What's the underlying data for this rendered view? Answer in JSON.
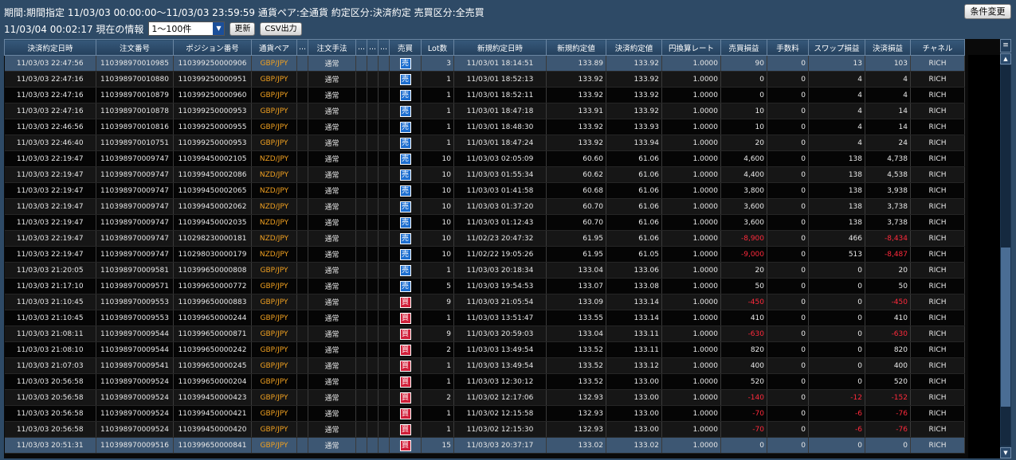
{
  "header": {
    "conditions": "期間:期間指定  11/03/03 00:00:00～11/03/03 23:59:59   通貨ペア:全通貨   約定区分:決済約定   売買区分:全売買",
    "change_button": "条件変更",
    "info": "11/03/04 00:02:17 現在の情報",
    "range_value": "1～100件",
    "refresh_button": "更新",
    "csv_button": "CSV出力"
  },
  "table": {
    "columns": [
      "決済約定日時",
      "注文番号",
      "ポジション番号",
      "通貨ペア",
      "...",
      "注文手法",
      "...",
      "...",
      "...",
      "売買",
      "Lot数",
      "新規約定日時",
      "新規約定値",
      "決済約定値",
      "円換算レート",
      "売買損益",
      "手数料",
      "スワップ損益",
      "決済損益",
      "チャネル"
    ],
    "rows": [
      [
        "11/03/03 22:47:56",
        "110398970010985",
        "110399250000906",
        "GBP/JPY",
        "",
        "通常",
        "",
        "",
        "",
        "売",
        "3",
        "11/03/01 18:14:51",
        "133.89",
        "133.92",
        "1.0000",
        "90",
        "0",
        "13",
        "103",
        "RICH"
      ],
      [
        "11/03/03 22:47:16",
        "110398970010880",
        "110399250000951",
        "GBP/JPY",
        "",
        "通常",
        "",
        "",
        "",
        "売",
        "1",
        "11/03/01 18:52:13",
        "133.92",
        "133.92",
        "1.0000",
        "0",
        "0",
        "4",
        "4",
        "RICH"
      ],
      [
        "11/03/03 22:47:16",
        "110398970010879",
        "110399250000960",
        "GBP/JPY",
        "",
        "通常",
        "",
        "",
        "",
        "売",
        "1",
        "11/03/01 18:52:11",
        "133.92",
        "133.92",
        "1.0000",
        "0",
        "0",
        "4",
        "4",
        "RICH"
      ],
      [
        "11/03/03 22:47:16",
        "110398970010878",
        "110399250000953",
        "GBP/JPY",
        "",
        "通常",
        "",
        "",
        "",
        "売",
        "1",
        "11/03/01 18:47:18",
        "133.91",
        "133.92",
        "1.0000",
        "10",
        "0",
        "4",
        "14",
        "RICH"
      ],
      [
        "11/03/03 22:46:56",
        "110398970010816",
        "110399250000955",
        "GBP/JPY",
        "",
        "通常",
        "",
        "",
        "",
        "売",
        "1",
        "11/03/01 18:48:30",
        "133.92",
        "133.93",
        "1.0000",
        "10",
        "0",
        "4",
        "14",
        "RICH"
      ],
      [
        "11/03/03 22:46:40",
        "110398970010751",
        "110399250000953",
        "GBP/JPY",
        "",
        "通常",
        "",
        "",
        "",
        "売",
        "1",
        "11/03/01 18:47:24",
        "133.92",
        "133.94",
        "1.0000",
        "20",
        "0",
        "4",
        "24",
        "RICH"
      ],
      [
        "11/03/03 22:19:47",
        "110398970009747",
        "110399450002105",
        "NZD/JPY",
        "",
        "通常",
        "",
        "",
        "",
        "売",
        "10",
        "11/03/03 02:05:09",
        "60.60",
        "61.06",
        "1.0000",
        "4,600",
        "0",
        "138",
        "4,738",
        "RICH"
      ],
      [
        "11/03/03 22:19:47",
        "110398970009747",
        "110399450002086",
        "NZD/JPY",
        "",
        "通常",
        "",
        "",
        "",
        "売",
        "10",
        "11/03/03 01:55:34",
        "60.62",
        "61.06",
        "1.0000",
        "4,400",
        "0",
        "138",
        "4,538",
        "RICH"
      ],
      [
        "11/03/03 22:19:47",
        "110398970009747",
        "110399450002065",
        "NZD/JPY",
        "",
        "通常",
        "",
        "",
        "",
        "売",
        "10",
        "11/03/03 01:41:58",
        "60.68",
        "61.06",
        "1.0000",
        "3,800",
        "0",
        "138",
        "3,938",
        "RICH"
      ],
      [
        "11/03/03 22:19:47",
        "110398970009747",
        "110399450002062",
        "NZD/JPY",
        "",
        "通常",
        "",
        "",
        "",
        "売",
        "10",
        "11/03/03 01:37:20",
        "60.70",
        "61.06",
        "1.0000",
        "3,600",
        "0",
        "138",
        "3,738",
        "RICH"
      ],
      [
        "11/03/03 22:19:47",
        "110398970009747",
        "110399450002035",
        "NZD/JPY",
        "",
        "通常",
        "",
        "",
        "",
        "売",
        "10",
        "11/03/03 01:12:43",
        "60.70",
        "61.06",
        "1.0000",
        "3,600",
        "0",
        "138",
        "3,738",
        "RICH"
      ],
      [
        "11/03/03 22:19:47",
        "110398970009747",
        "110298230000181",
        "NZD/JPY",
        "",
        "通常",
        "",
        "",
        "",
        "売",
        "10",
        "11/02/23 20:47:32",
        "61.95",
        "61.06",
        "1.0000",
        "-8,900",
        "0",
        "466",
        "-8,434",
        "RICH"
      ],
      [
        "11/03/03 22:19:47",
        "110398970009747",
        "110298030000179",
        "NZD/JPY",
        "",
        "通常",
        "",
        "",
        "",
        "売",
        "10",
        "11/02/22 19:05:26",
        "61.95",
        "61.05",
        "1.0000",
        "-9,000",
        "0",
        "513",
        "-8,487",
        "RICH"
      ],
      [
        "11/03/03 21:20:05",
        "110398970009581",
        "110399650000808",
        "GBP/JPY",
        "",
        "通常",
        "",
        "",
        "",
        "売",
        "1",
        "11/03/03 20:18:34",
        "133.04",
        "133.06",
        "1.0000",
        "20",
        "0",
        "0",
        "20",
        "RICH"
      ],
      [
        "11/03/03 21:17:10",
        "110398970009571",
        "110399650000772",
        "GBP/JPY",
        "",
        "通常",
        "",
        "",
        "",
        "売",
        "5",
        "11/03/03 19:54:53",
        "133.07",
        "133.08",
        "1.0000",
        "50",
        "0",
        "0",
        "50",
        "RICH"
      ],
      [
        "11/03/03 21:10:45",
        "110398970009553",
        "110399650000883",
        "GBP/JPY",
        "",
        "通常",
        "",
        "",
        "",
        "買",
        "9",
        "11/03/03 21:05:54",
        "133.09",
        "133.14",
        "1.0000",
        "-450",
        "0",
        "0",
        "-450",
        "RICH"
      ],
      [
        "11/03/03 21:10:45",
        "110398970009553",
        "110399650000244",
        "GBP/JPY",
        "",
        "通常",
        "",
        "",
        "",
        "買",
        "1",
        "11/03/03 13:51:47",
        "133.55",
        "133.14",
        "1.0000",
        "410",
        "0",
        "0",
        "410",
        "RICH"
      ],
      [
        "11/03/03 21:08:11",
        "110398970009544",
        "110399650000871",
        "GBP/JPY",
        "",
        "通常",
        "",
        "",
        "",
        "買",
        "9",
        "11/03/03 20:59:03",
        "133.04",
        "133.11",
        "1.0000",
        "-630",
        "0",
        "0",
        "-630",
        "RICH"
      ],
      [
        "11/03/03 21:08:10",
        "110398970009544",
        "110399650000242",
        "GBP/JPY",
        "",
        "通常",
        "",
        "",
        "",
        "買",
        "2",
        "11/03/03 13:49:54",
        "133.52",
        "133.11",
        "1.0000",
        "820",
        "0",
        "0",
        "820",
        "RICH"
      ],
      [
        "11/03/03 21:07:03",
        "110398970009541",
        "110399650000245",
        "GBP/JPY",
        "",
        "通常",
        "",
        "",
        "",
        "買",
        "1",
        "11/03/03 13:49:54",
        "133.52",
        "133.12",
        "1.0000",
        "400",
        "0",
        "0",
        "400",
        "RICH"
      ],
      [
        "11/03/03 20:56:58",
        "110398970009524",
        "110399650000204",
        "GBP/JPY",
        "",
        "通常",
        "",
        "",
        "",
        "買",
        "1",
        "11/03/03 12:30:12",
        "133.52",
        "133.00",
        "1.0000",
        "520",
        "0",
        "0",
        "520",
        "RICH"
      ],
      [
        "11/03/03 20:56:58",
        "110398970009524",
        "110399450000423",
        "GBP/JPY",
        "",
        "通常",
        "",
        "",
        "",
        "買",
        "2",
        "11/03/02 12:17:06",
        "132.93",
        "133.00",
        "1.0000",
        "-140",
        "0",
        "-12",
        "-152",
        "RICH"
      ],
      [
        "11/03/03 20:56:58",
        "110398970009524",
        "110399450000421",
        "GBP/JPY",
        "",
        "通常",
        "",
        "",
        "",
        "買",
        "1",
        "11/03/02 12:15:58",
        "132.93",
        "133.00",
        "1.0000",
        "-70",
        "0",
        "-6",
        "-76",
        "RICH"
      ],
      [
        "11/03/03 20:56:58",
        "110398970009524",
        "110399450000420",
        "GBP/JPY",
        "",
        "通常",
        "",
        "",
        "",
        "買",
        "1",
        "11/03/02 12:15:30",
        "132.93",
        "133.00",
        "1.0000",
        "-70",
        "0",
        "-6",
        "-76",
        "RICH"
      ],
      [
        "11/03/03 20:51:31",
        "110398970009516",
        "110399650000841",
        "GBP/JPY",
        "",
        "通常",
        "",
        "",
        "",
        "買",
        "15",
        "11/03/03 20:37:17",
        "133.02",
        "133.02",
        "1.0000",
        "0",
        "0",
        "0",
        "0",
        "RICH"
      ]
    ]
  },
  "colors": {
    "background": "#2e4a66",
    "pair": "#f0a020",
    "negative": "#ff2a3c",
    "sell_badge": "#1e6fd0",
    "buy_badge": "#d0203a",
    "selected_row": "#3d5773"
  }
}
